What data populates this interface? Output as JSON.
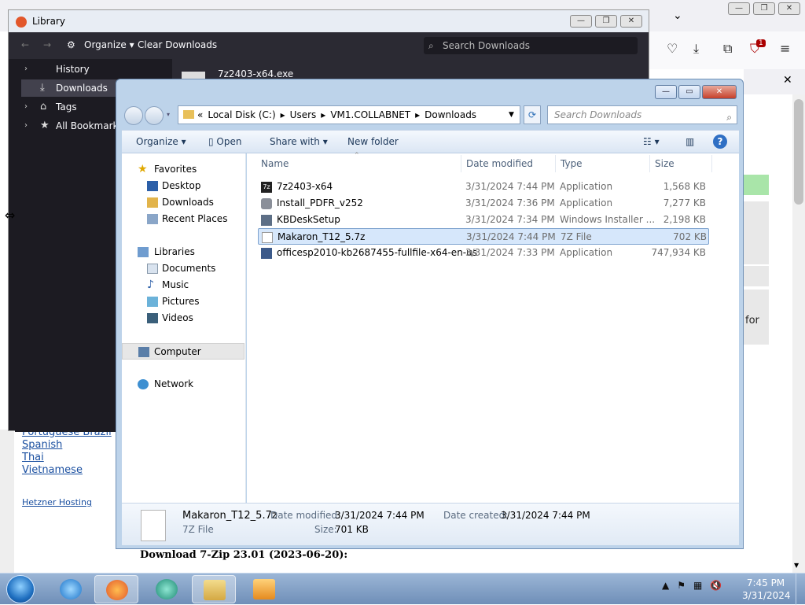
{
  "firefox": {
    "notification_close": "✕",
    "ublock_count": "1"
  },
  "page": {
    "languages": [
      "Portuguese Brazil",
      "Spanish",
      "Thai",
      "Vietnamese"
    ],
    "hosting_link": "Hetzner Hosting",
    "download_heading": "Download 7-Zip 23.01 (2023-06-20):",
    "partial_text": "for"
  },
  "library": {
    "title": "Library",
    "organize_label": "Organize",
    "clear_downloads_label": "Clear Downloads",
    "search_placeholder": "Search Downloads",
    "sidebar": [
      {
        "label": "History",
        "icon": "history-icon",
        "selected": false
      },
      {
        "label": "Downloads",
        "icon": "download-icon",
        "selected": true
      },
      {
        "label": "Tags",
        "icon": "tag-icon",
        "selected": false
      },
      {
        "label": "All Bookmarks",
        "icon": "star-icon",
        "selected": false
      }
    ],
    "download_item": "7z2403-x64.exe"
  },
  "explorer": {
    "breadcrumb": [
      "«",
      "Local Disk (C:)",
      "Users",
      "VM1.COLLABNET",
      "Downloads"
    ],
    "search_placeholder": "Search Downloads",
    "commands": {
      "organize": "Organize",
      "open": "Open",
      "share_with": "Share with",
      "new_folder": "New folder"
    },
    "nav": {
      "favorites": "Favorites",
      "desktop": "Desktop",
      "downloads": "Downloads",
      "recent_places": "Recent Places",
      "libraries": "Libraries",
      "documents": "Documents",
      "music": "Music",
      "pictures": "Pictures",
      "videos": "Videos",
      "computer": "Computer",
      "network": "Network"
    },
    "columns": {
      "name": "Name",
      "date_modified": "Date modified",
      "type": "Type",
      "size": "Size"
    },
    "files": [
      {
        "name": "7z2403-x64",
        "date": "3/31/2024 7:44 PM",
        "type": "Application",
        "size": "1,568 KB",
        "icon": "7zip-app-icon"
      },
      {
        "name": "Install_PDFR_v252",
        "date": "3/31/2024 7:36 PM",
        "type": "Application",
        "size": "7,277 KB",
        "icon": "installer-app-icon"
      },
      {
        "name": "KBDeskSetup",
        "date": "3/31/2024 7:34 PM",
        "type": "Windows Installer ...",
        "size": "2,198 KB",
        "icon": "msi-icon"
      },
      {
        "name": "Makaron_T12_5.7z",
        "date": "3/31/2024 7:44 PM",
        "type": "7Z File",
        "size": "702 KB",
        "icon": "file-icon"
      },
      {
        "name": "officesp2010-kb2687455-fullfile-x64-en-us",
        "date": "3/31/2024 7:33 PM",
        "type": "Application",
        "size": "747,934 KB",
        "icon": "office-app-icon"
      }
    ],
    "details": {
      "filename": "Makaron_T12_5.7z",
      "filetype": "7Z File",
      "date_modified_label": "Date modified:",
      "date_modified": "3/31/2024 7:44 PM",
      "date_created_label": "Date created:",
      "date_created": "3/31/2024 7:44 PM",
      "size_label": "Size:",
      "size": "701 KB"
    }
  },
  "taskbar": {
    "time": "7:45 PM",
    "date": "3/31/2024"
  }
}
